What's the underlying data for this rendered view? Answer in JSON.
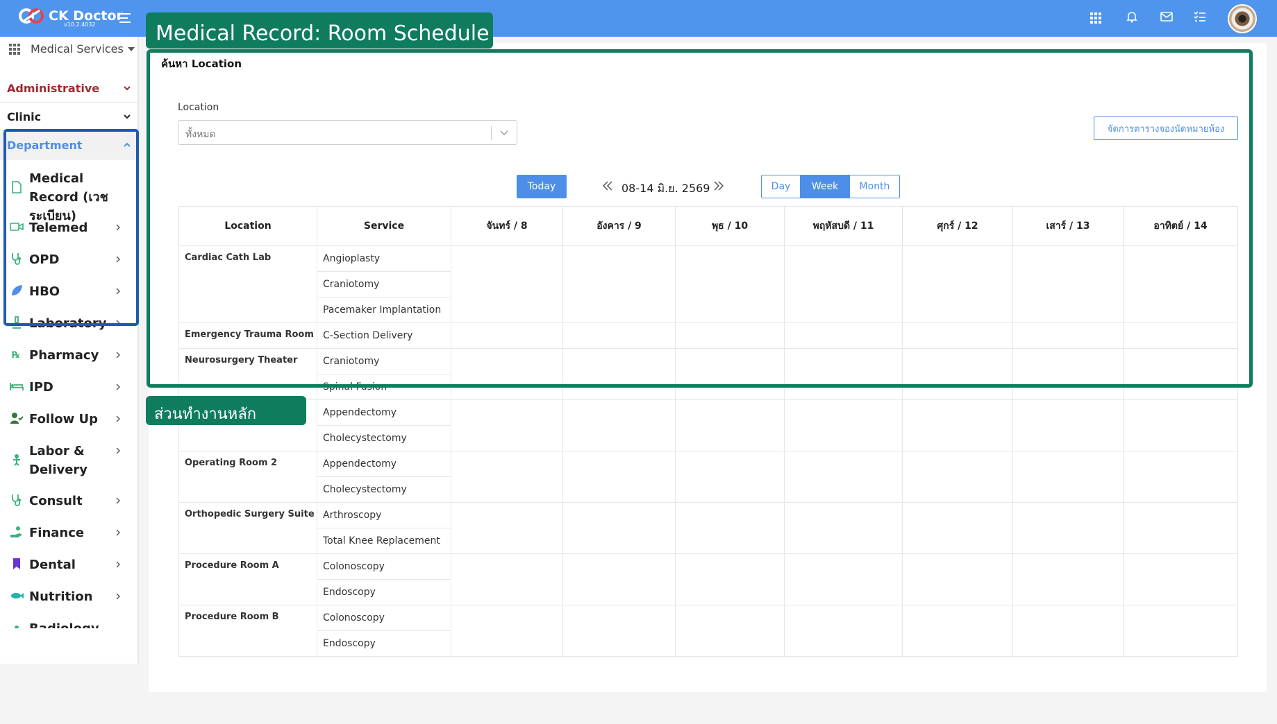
{
  "app": {
    "name": "CK Doctor",
    "version": "v10.2.4032"
  },
  "sidebar": {
    "service_selector": "Medical Services",
    "sections": {
      "administrative": "Administrative",
      "clinic": "Clinic",
      "department": "Department"
    },
    "items": [
      {
        "label": "Medical Record (เวชระเบียน)",
        "icon": "document-icon"
      },
      {
        "label": "Telemed",
        "icon": "video-icon"
      },
      {
        "label": "OPD",
        "icon": "stethoscope-icon"
      },
      {
        "label": "HBO",
        "icon": "leaf-icon"
      },
      {
        "label": "Laboratory",
        "icon": "microscope-icon"
      },
      {
        "label": "Pharmacy",
        "icon": "rx-icon"
      },
      {
        "label": "IPD",
        "icon": "bed-icon"
      },
      {
        "label": "Follow Up",
        "icon": "user-check-icon"
      },
      {
        "label": "Labor & Delivery",
        "icon": "baby-icon"
      },
      {
        "label": "Consult",
        "icon": "stethoscope-icon"
      },
      {
        "label": "Finance",
        "icon": "hand-money-icon"
      },
      {
        "label": "Dental",
        "icon": "tooth-icon"
      },
      {
        "label": "Nutrition",
        "icon": "fish-icon"
      },
      {
        "label": "Radiology",
        "icon": "radiology-icon"
      }
    ]
  },
  "search": {
    "title": "ค้นหา Location",
    "location_label": "Location",
    "location_value": "ทั้งหมด",
    "manage_button": "จัดการตารางจองนัดหมายห้อง"
  },
  "calendar": {
    "today_label": "Today",
    "date_range": "08-14 มิ.ย. 2569",
    "views": [
      "Day",
      "Week",
      "Month"
    ],
    "active_view": "Week"
  },
  "table": {
    "headers": [
      "Location",
      "Service",
      "จันทร์ / 8",
      "อังคาร / 9",
      "พุธ / 10",
      "พฤหัสบดี / 11",
      "ศุกร์ / 12",
      "เสาร์ / 13",
      "อาทิตย์ / 14"
    ],
    "locations": [
      {
        "name": "Cardiac Cath Lab",
        "services": [
          "Angioplasty",
          "Craniotomy",
          "Pacemaker Implantation"
        ]
      },
      {
        "name": "Emergency Trauma Room",
        "services": [
          "C-Section Delivery"
        ]
      },
      {
        "name": "Neurosurgery Theater",
        "services": [
          "Craniotomy",
          "Spinal Fusion"
        ]
      },
      {
        "name": "",
        "services": [
          "Appendectomy",
          "Cholecystectomy"
        ]
      },
      {
        "name": "Operating Room 2",
        "services": [
          "Appendectomy",
          "Cholecystectomy"
        ]
      },
      {
        "name": "Orthopedic Surgery Suite",
        "services": [
          "Arthroscopy",
          "Total Knee Replacement"
        ]
      },
      {
        "name": "Procedure Room A",
        "services": [
          "Colonoscopy",
          "Endoscopy"
        ]
      },
      {
        "name": "Procedure Room B",
        "services": [
          "Colonoscopy",
          "Endoscopy"
        ]
      }
    ]
  },
  "annotations": {
    "title": "Medical Record: Room Schedule",
    "main_area": "ส่วนทำงานหลัก"
  },
  "colors": {
    "topbar": "#4f95ee",
    "accent": "#4d8fe8",
    "annotation_green": "#0f7c5e",
    "annotation_blue": "#1d5ab4",
    "administrative": "#a3282f"
  }
}
